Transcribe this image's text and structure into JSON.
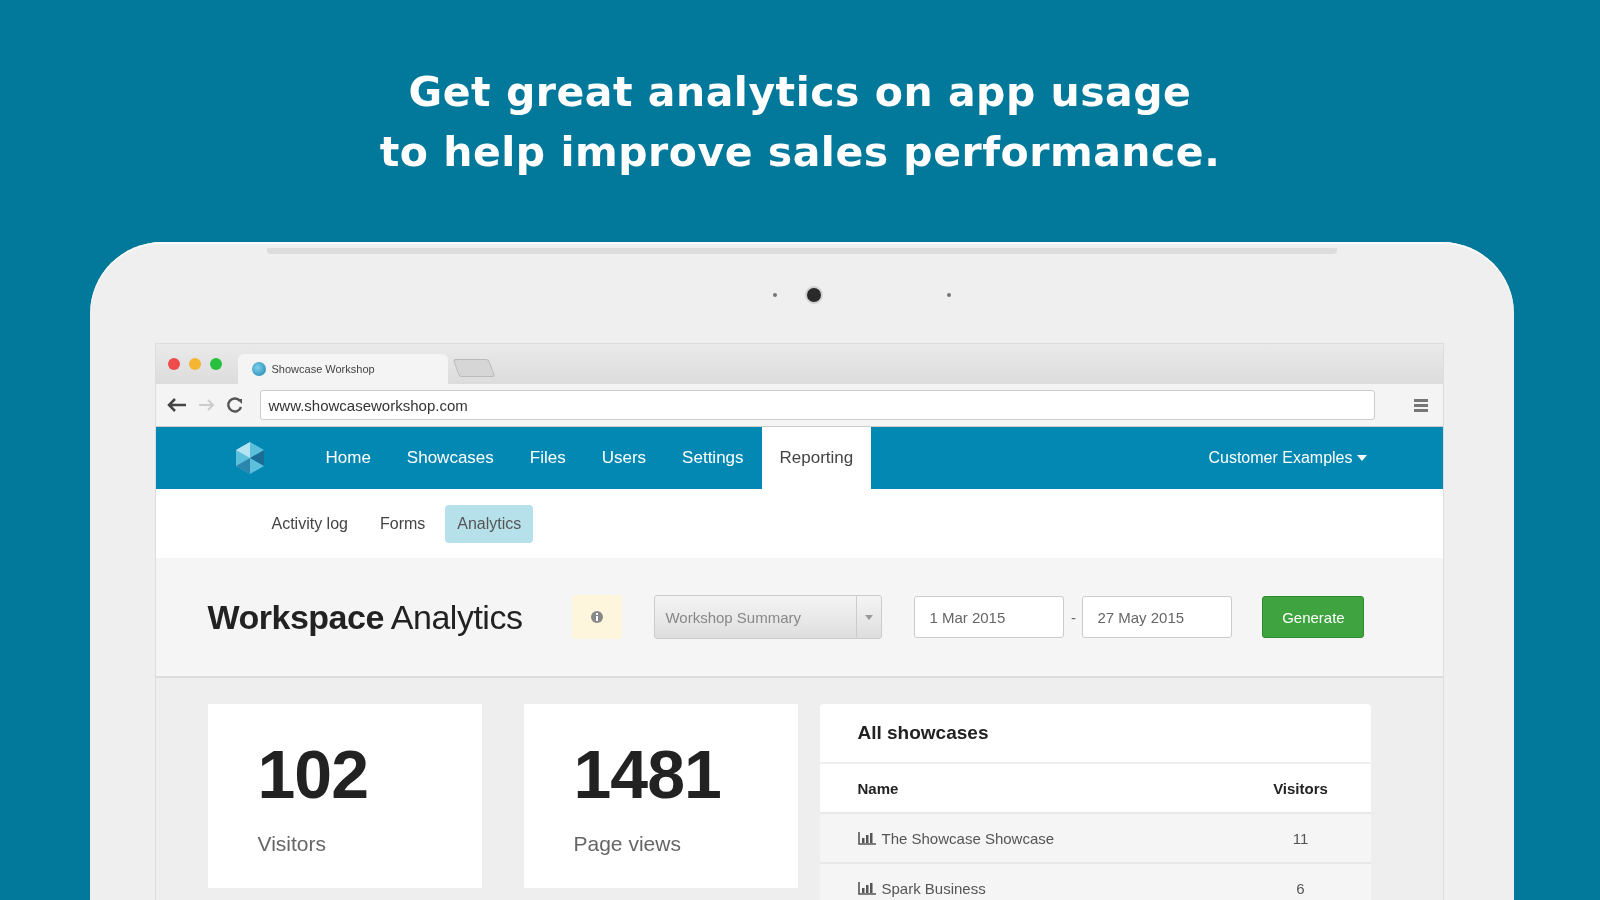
{
  "headline": [
    "Get great analytics on app usage",
    "to help improve sales performance."
  ],
  "browser": {
    "tab_title": "Showcase Workshop",
    "url": "www.showcaseworkshop.com"
  },
  "nav": {
    "items": [
      {
        "label": "Home",
        "selected": false
      },
      {
        "label": "Showcases",
        "selected": false
      },
      {
        "label": "Files",
        "selected": false
      },
      {
        "label": "Users",
        "selected": false
      },
      {
        "label": "Settings",
        "selected": false
      },
      {
        "label": "Reporting",
        "selected": true
      }
    ],
    "account": "Customer Examples"
  },
  "subnav": [
    {
      "label": "Activity log",
      "selected": false
    },
    {
      "label": "Forms",
      "selected": false
    },
    {
      "label": "Analytics",
      "selected": true
    }
  ],
  "header": {
    "title": "**Workspace** Analytics",
    "report": "Workshop Summary",
    "date_from": "1 Mar 2015",
    "date_separator": "-",
    "date_to": "27 May 2015",
    "button": "Generate"
  },
  "stats": [
    {
      "value": "102",
      "label": "Visitors"
    },
    {
      "value": "1481",
      "label": "Page views"
    }
  ],
  "table": {
    "title": "All showcases",
    "columns": [
      "Name",
      "Visitors"
    ],
    "rows": [
      {
        "name": "The Showcase Showcase",
        "visitors": "11"
      },
      {
        "name": "Spark Business",
        "visitors": "6"
      }
    ]
  }
}
